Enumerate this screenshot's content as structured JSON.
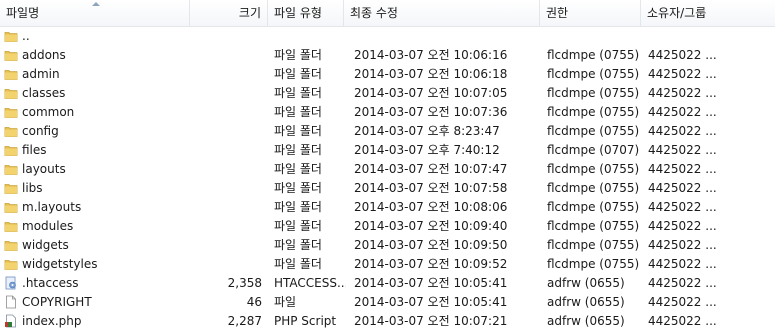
{
  "columns": {
    "name": "파일명",
    "size": "크기",
    "type": "파일 유형",
    "modified": "최종 수정",
    "permissions": "권한",
    "owner": "소유자/그룹"
  },
  "rows": [
    {
      "name": "..",
      "size": "",
      "type": "",
      "modified": "",
      "permissions": "",
      "owner": "",
      "icon": "folder-icon"
    },
    {
      "name": "addons",
      "size": "",
      "type": "파일 폴더",
      "modified": "2014-03-07 오전 10:06:16",
      "permissions": "flcdmpe (0755)",
      "owner": "4425022 ...",
      "icon": "folder-icon"
    },
    {
      "name": "admin",
      "size": "",
      "type": "파일 폴더",
      "modified": "2014-03-07 오전 10:06:18",
      "permissions": "flcdmpe (0755)",
      "owner": "4425022 ...",
      "icon": "folder-icon"
    },
    {
      "name": "classes",
      "size": "",
      "type": "파일 폴더",
      "modified": "2014-03-07 오전 10:07:05",
      "permissions": "flcdmpe (0755)",
      "owner": "4425022 ...",
      "icon": "folder-icon"
    },
    {
      "name": "common",
      "size": "",
      "type": "파일 폴더",
      "modified": "2014-03-07 오전 10:07:36",
      "permissions": "flcdmpe (0755)",
      "owner": "4425022 ...",
      "icon": "folder-icon"
    },
    {
      "name": "config",
      "size": "",
      "type": "파일 폴더",
      "modified": "2014-03-07 오후 8:23:47",
      "permissions": "flcdmpe (0755)",
      "owner": "4425022 ...",
      "icon": "folder-icon"
    },
    {
      "name": "files",
      "size": "",
      "type": "파일 폴더",
      "modified": "2014-03-07 오후 7:40:12",
      "permissions": "flcdmpe (0707)",
      "owner": "4425022 ...",
      "icon": "folder-icon"
    },
    {
      "name": "layouts",
      "size": "",
      "type": "파일 폴더",
      "modified": "2014-03-07 오전 10:07:47",
      "permissions": "flcdmpe (0755)",
      "owner": "4425022 ...",
      "icon": "folder-icon"
    },
    {
      "name": "libs",
      "size": "",
      "type": "파일 폴더",
      "modified": "2014-03-07 오전 10:07:58",
      "permissions": "flcdmpe (0755)",
      "owner": "4425022 ...",
      "icon": "folder-icon"
    },
    {
      "name": "m.layouts",
      "size": "",
      "type": "파일 폴더",
      "modified": "2014-03-07 오전 10:08:06",
      "permissions": "flcdmpe (0755)",
      "owner": "4425022 ...",
      "icon": "folder-icon"
    },
    {
      "name": "modules",
      "size": "",
      "type": "파일 폴더",
      "modified": "2014-03-07 오전 10:09:40",
      "permissions": "flcdmpe (0755)",
      "owner": "4425022 ...",
      "icon": "folder-icon"
    },
    {
      "name": "widgets",
      "size": "",
      "type": "파일 폴더",
      "modified": "2014-03-07 오전 10:09:50",
      "permissions": "flcdmpe (0755)",
      "owner": "4425022 ...",
      "icon": "folder-icon"
    },
    {
      "name": "widgetstyles",
      "size": "",
      "type": "파일 폴더",
      "modified": "2014-03-07 오전 10:09:52",
      "permissions": "flcdmpe (0755)",
      "owner": "4425022 ...",
      "icon": "folder-icon"
    },
    {
      "name": ".htaccess",
      "size": "2,358",
      "type": "HTACCESS...",
      "modified": "2014-03-07 오전 10:05:41",
      "permissions": "adfrw (0655)",
      "owner": "4425022 ...",
      "icon": "htaccess-file-icon"
    },
    {
      "name": "COPYRIGHT",
      "size": "46",
      "type": "파일",
      "modified": "2014-03-07 오전 10:05:41",
      "permissions": "adfrw (0655)",
      "owner": "4425022 ...",
      "icon": "blank-file-icon"
    },
    {
      "name": "index.php",
      "size": "2,287",
      "type": "PHP Script",
      "modified": "2014-03-07 오전 10:07:21",
      "permissions": "adfrw (0655)",
      "owner": "4425022 ...",
      "icon": "php-file-icon"
    }
  ],
  "colors": {
    "header_border": "#e3e6ea",
    "folder_yellow": "#e8c154",
    "sort_arrow": "#8fa3bd"
  }
}
